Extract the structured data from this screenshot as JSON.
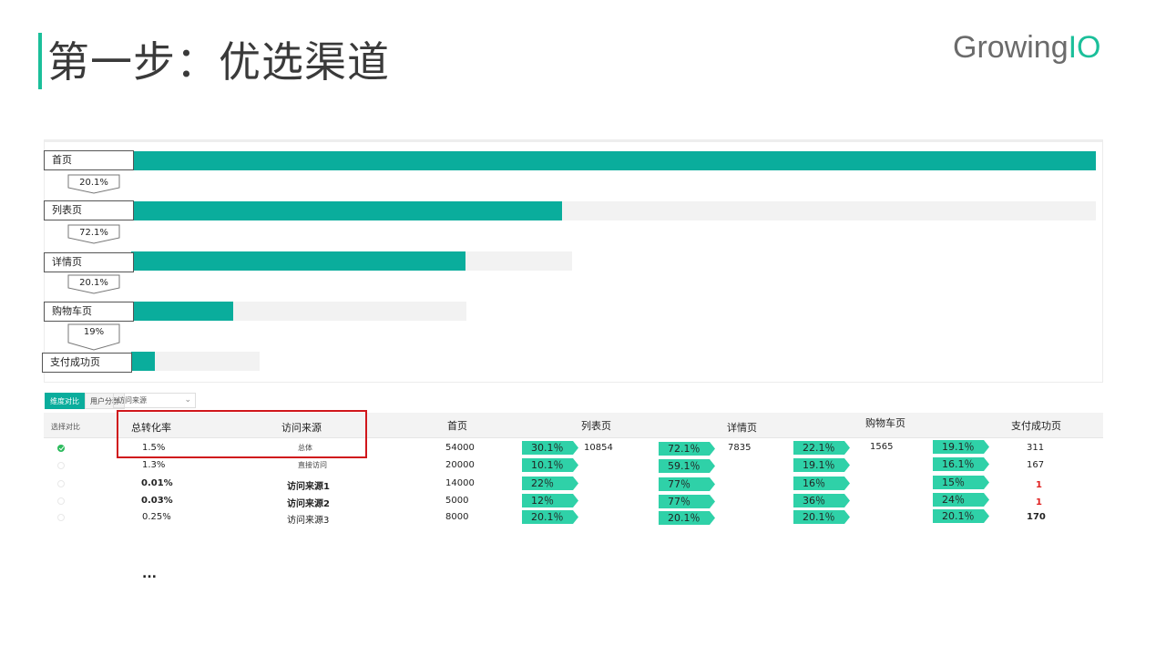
{
  "slide": {
    "title": "第一步：优选渠道",
    "logo_main": "Growing",
    "logo_accent": "IO",
    "accent_color": "#1bbf9a",
    "bar_color": "#0aad9c",
    "ellipsis": "..."
  },
  "funnel": {
    "steps": [
      {
        "label": "首页",
        "fraction": 1.0
      },
      {
        "label": "列表页",
        "fraction": 0.4466
      },
      {
        "label": "详情页",
        "fraction": 0.7588
      },
      {
        "label": "购物车页",
        "fraction": 0.3055
      },
      {
        "label": "支付成功页",
        "fraction": 0.1859
      }
    ],
    "rates": [
      "20.1%",
      "72.1%",
      "20.1%",
      "19%"
    ]
  },
  "controls": {
    "tabs": [
      {
        "label": "维度对比",
        "active": true
      },
      {
        "label": "用户分群",
        "active": false
      }
    ],
    "select_value": "访问来源",
    "select_icon": "chevron-down-icon"
  },
  "table": {
    "headers": {
      "select": "选择对比",
      "total_rate": "总转化率",
      "source": "访问来源",
      "home": "首页",
      "list": "列表页",
      "detail": "详情页",
      "cart": "购物车页",
      "paid": "支付成功页"
    },
    "rows": [
      {
        "checked": true,
        "rate": "1.5%",
        "source": "总体",
        "home": "54000",
        "r1": "30.1％",
        "list": "10854",
        "r2": "72.1％",
        "detail": "7835",
        "r3": "22.1％",
        "cart": "1565",
        "r4": "19.1％",
        "paid": "311",
        "style": "tiny"
      },
      {
        "checked": false,
        "rate": "1.3%",
        "source": "直接访问",
        "home": "20000",
        "r1": "10.1％",
        "list": "",
        "r2": "59.1％",
        "detail": "",
        "r3": "19.1％",
        "cart": "",
        "r4": "16.1％",
        "paid": "167",
        "style": "tiny"
      },
      {
        "checked": false,
        "rate": "0.01%",
        "source": "访问来源1",
        "home": "14000",
        "r1": "22％",
        "list": "",
        "r2": "77％",
        "detail": "",
        "r3": "16％",
        "cart": "",
        "r4": "15％",
        "paid": "1",
        "style": "bold"
      },
      {
        "checked": false,
        "rate": "0.03%",
        "source": "访问来源2",
        "home": "5000",
        "r1": "12％",
        "list": "",
        "r2": "77％",
        "detail": "",
        "r3": "36％",
        "cart": "",
        "r4": "24％",
        "paid": "1",
        "style": "bold"
      },
      {
        "checked": false,
        "rate": "0.25%",
        "source": "访问来源3",
        "home": "8000",
        "r1": "20.1％",
        "list": "",
        "r2": "20.1％",
        "detail": "",
        "r3": "20.1％",
        "cart": "",
        "r4": "20.1％",
        "paid": "170",
        "style": "normal"
      }
    ]
  }
}
